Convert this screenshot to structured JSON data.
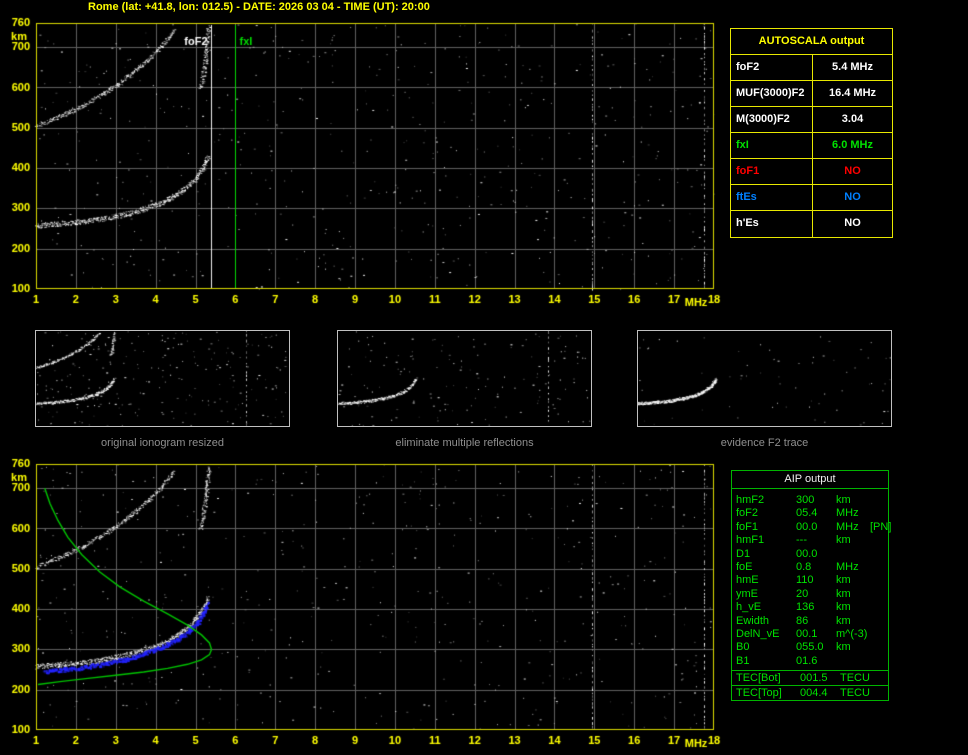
{
  "title": "Rome (lat: +41.8, lon: 012.5) - DATE: 2026 03 04 - TIME (UT): 20:00",
  "colors": {
    "accent_yellow": "#ffff00",
    "accent_green": "#00e100",
    "accent_red": "#ff0000",
    "accent_blue": "#0080ff",
    "trace_white": "#ffffff",
    "profile_green": "#00c400",
    "restored_blue": "#2323ff",
    "grid_gray": "#616161",
    "caption_gray": "#8f8f8f"
  },
  "autoscala_table": {
    "title": "AUTOSCALA output",
    "rows": [
      {
        "label": "foF2",
        "value": "5.4 MHz",
        "color": "#ffffff"
      },
      {
        "label": "MUF(3000)F2",
        "value": "16.4 MHz",
        "color": "#ffffff"
      },
      {
        "label": "M(3000)F2",
        "value": "3.04",
        "color": "#ffffff"
      },
      {
        "label": "fxI",
        "value": "6.0 MHz",
        "color": "#00e100"
      },
      {
        "label": "foF1",
        "value": "NO",
        "color": "#ff0000"
      },
      {
        "label": "ftEs",
        "value": "NO",
        "color": "#0080ff"
      },
      {
        "label": "h'Es",
        "value": "NO",
        "color": "#ffffff"
      }
    ]
  },
  "aip_table": {
    "title": "AIP output",
    "rows": [
      {
        "label": "hmF2",
        "value": "300",
        "unit": "km",
        "note": ""
      },
      {
        "label": "foF2",
        "value": "05.4",
        "unit": "MHz",
        "note": ""
      },
      {
        "label": "foF1",
        "value": "00.0",
        "unit": "MHz",
        "note": "[PN]"
      },
      {
        "label": "hmF1",
        "value": "---",
        "unit": "km",
        "note": ""
      },
      {
        "label": "D1",
        "value": "00.0",
        "unit": "",
        "note": ""
      },
      {
        "label": "foE",
        "value": "0.8",
        "unit": "MHz",
        "note": ""
      },
      {
        "label": "hmE",
        "value": "110",
        "unit": "km",
        "note": ""
      },
      {
        "label": "ymE",
        "value": "20",
        "unit": "km",
        "note": ""
      },
      {
        "label": "h_vE",
        "value": "136",
        "unit": "km",
        "note": ""
      },
      {
        "label": "Ewidth",
        "value": "86",
        "unit": "km",
        "note": ""
      },
      {
        "label": "DelN_vE",
        "value": "00.1",
        "unit": "m^(-3)",
        "note": ""
      },
      {
        "label": "B0",
        "value": "055.0",
        "unit": "km",
        "note": ""
      },
      {
        "label": "B1",
        "value": "01.6",
        "unit": "",
        "note": ""
      }
    ],
    "tec_rows": [
      {
        "label": "TEC[Bot]",
        "value": "001.5",
        "unit": "TECU"
      },
      {
        "label": "TEC[Top]",
        "value": "004.4",
        "unit": "TECU"
      }
    ]
  },
  "thumbnails": [
    {
      "caption": "original ionogram resized",
      "series_ref": [
        0,
        1,
        2
      ],
      "noise": 240,
      "seed": 5,
      "boost": 1,
      "interference_mhz": [
        12.6
      ]
    },
    {
      "caption": "eliminate multiple reflections",
      "series_ref": [
        0
      ],
      "noise": 150,
      "seed": 6,
      "boost": 1,
      "interference_mhz": [
        12.6
      ]
    },
    {
      "caption": "evidence F2 trace",
      "series_ref": [
        0
      ],
      "noise": 70,
      "seed": 7,
      "boost": 1.6,
      "interference_mhz": []
    }
  ],
  "thumbnail_xlim": [
    1,
    15
  ],
  "chart_data": [
    {
      "id": "autoscaled_ionogram",
      "type": "scatter",
      "title": "ionogram with autoscaled characteristics",
      "xlabel": "MHz",
      "ylabel": "km",
      "xlim": [
        1,
        18
      ],
      "ylim": [
        100,
        760
      ],
      "x_ticks": [
        1,
        2,
        3,
        4,
        5,
        6,
        7,
        8,
        9,
        10,
        11,
        12,
        13,
        14,
        15,
        16,
        17,
        18
      ],
      "y_ticks": [
        100,
        200,
        300,
        400,
        500,
        600,
        700,
        760
      ],
      "grid": true,
      "legend": false,
      "noise": 560,
      "seed": 11,
      "interference_mhz": [
        14.95,
        17.75
      ],
      "annotations": [
        {
          "label": "foF2",
          "x": 5.4,
          "color": "#ffffff",
          "side": "left"
        },
        {
          "label": "fxI",
          "x": 6.0,
          "color": "#00dd00",
          "side": "right"
        }
      ],
      "series": [
        {
          "name": "F2 trace 1st hop",
          "style": "speckle",
          "color": "#ffffff",
          "density": 3,
          "jx": 3,
          "jy": 5,
          "points": [
            [
              1.0,
              258
            ],
            [
              1.5,
              262
            ],
            [
              2.0,
              266
            ],
            [
              2.5,
              272
            ],
            [
              3.0,
              281
            ],
            [
              3.5,
              293
            ],
            [
              4.0,
              309
            ],
            [
              4.3,
              322
            ],
            [
              4.6,
              340
            ],
            [
              4.85,
              360
            ],
            [
              5.05,
              382
            ],
            [
              5.2,
              405
            ],
            [
              5.3,
              428
            ]
          ]
        },
        {
          "name": "F2 trace 2nd hop",
          "style": "speckle",
          "color": "#ffffff",
          "density": 2,
          "jx": 3,
          "jy": 4,
          "points": [
            [
              1.0,
              505
            ],
            [
              1.4,
              521
            ],
            [
              1.8,
              539
            ],
            [
              2.2,
              558
            ],
            [
              2.6,
              580
            ],
            [
              3.0,
              606
            ],
            [
              3.4,
              636
            ],
            [
              3.8,
              669
            ],
            [
              4.15,
              704
            ],
            [
              4.45,
              742
            ]
          ]
        },
        {
          "name": "2nd hop cusp",
          "style": "speckle",
          "color": "#ffffff",
          "density": 2,
          "jx": 4,
          "jy": 3,
          "points": [
            [
              5.12,
              598
            ],
            [
              5.2,
              642
            ],
            [
              5.27,
              695
            ],
            [
              5.32,
              752
            ]
          ]
        }
      ]
    },
    {
      "id": "aip_profile_ionogram",
      "type": "scatter",
      "title": "ionogram with AIP electron density profile and restored trace",
      "xlabel": "MHz",
      "ylabel": "km",
      "xlim": [
        1,
        18
      ],
      "ylim": [
        100,
        760
      ],
      "x_ticks": [
        1,
        2,
        3,
        4,
        5,
        6,
        7,
        8,
        9,
        10,
        11,
        12,
        13,
        14,
        15,
        16,
        17,
        18
      ],
      "y_ticks": [
        100,
        200,
        300,
        400,
        500,
        600,
        700,
        760
      ],
      "grid": true,
      "legend": false,
      "noise": 520,
      "seed": 23,
      "interference_mhz": [
        14.95,
        17.75
      ],
      "annotations": [],
      "series": [
        {
          "name": "F2 trace 1st hop",
          "style": "speckle",
          "color": "#ffffff",
          "density": 3,
          "jx": 3,
          "jy": 5,
          "points": [
            [
              1.0,
              258
            ],
            [
              1.5,
              262
            ],
            [
              2.0,
              266
            ],
            [
              2.5,
              272
            ],
            [
              3.0,
              281
            ],
            [
              3.5,
              293
            ],
            [
              4.0,
              309
            ],
            [
              4.3,
              322
            ],
            [
              4.6,
              340
            ],
            [
              4.85,
              360
            ],
            [
              5.05,
              382
            ],
            [
              5.2,
              405
            ],
            [
              5.3,
              428
            ]
          ]
        },
        {
          "name": "F2 trace 2nd hop",
          "style": "speckle",
          "color": "#ffffff",
          "density": 2,
          "jx": 3,
          "jy": 4,
          "points": [
            [
              1.0,
              505
            ],
            [
              1.4,
              521
            ],
            [
              1.8,
              539
            ],
            [
              2.2,
              558
            ],
            [
              2.6,
              580
            ],
            [
              3.0,
              606
            ],
            [
              3.4,
              636
            ],
            [
              3.8,
              669
            ],
            [
              4.15,
              704
            ],
            [
              4.45,
              742
            ]
          ]
        },
        {
          "name": "2nd hop cusp",
          "style": "speckle",
          "color": "#ffffff",
          "density": 2,
          "jx": 4,
          "jy": 3,
          "points": [
            [
              5.12,
              598
            ],
            [
              5.2,
              642
            ],
            [
              5.27,
              695
            ],
            [
              5.32,
              752
            ]
          ]
        },
        {
          "name": "restored F2 trace",
          "style": "dots",
          "color": "#2323ff",
          "density": 2,
          "jx": 3,
          "jy": 4,
          "points": [
            [
              1.2,
              246
            ],
            [
              1.7,
              251
            ],
            [
              2.2,
              257
            ],
            [
              2.7,
              265
            ],
            [
              3.2,
              276
            ],
            [
              3.7,
              290
            ],
            [
              4.1,
              305
            ],
            [
              4.5,
              324
            ],
            [
              4.8,
              345
            ],
            [
              5.05,
              370
            ],
            [
              5.2,
              394
            ],
            [
              5.3,
              416
            ]
          ]
        },
        {
          "name": "electron density profile",
          "style": "line",
          "color": "#00c400",
          "width": 1.4,
          "points": [
            [
              1.22,
              700
            ],
            [
              1.35,
              662
            ],
            [
              1.55,
              620
            ],
            [
              1.8,
              578
            ],
            [
              2.15,
              535
            ],
            [
              2.6,
              492
            ],
            [
              3.1,
              455
            ],
            [
              3.7,
              420
            ],
            [
              4.3,
              388
            ],
            [
              4.8,
              360
            ],
            [
              5.15,
              336
            ],
            [
              5.35,
              316
            ],
            [
              5.4,
              300
            ],
            [
              5.35,
              287
            ],
            [
              5.15,
              274
            ],
            [
              4.8,
              263
            ],
            [
              4.3,
              253
            ],
            [
              3.7,
              244
            ],
            [
              3.0,
              236
            ],
            [
              2.3,
              228
            ],
            [
              1.6,
              220
            ],
            [
              1.05,
              213
            ]
          ]
        }
      ]
    }
  ]
}
